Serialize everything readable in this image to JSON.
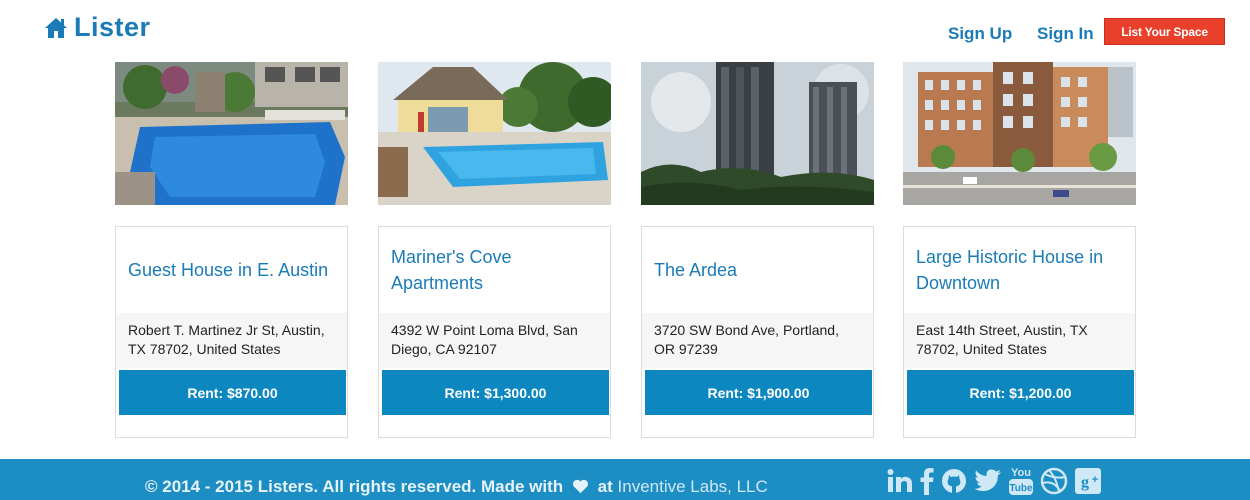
{
  "header": {
    "brand": "Lister",
    "sign_up": "Sign Up",
    "sign_in": "Sign In",
    "list_space": "List Your Space"
  },
  "listings": [
    {
      "title": "Guest House in E. Austin",
      "address": "Robert T. Martinez Jr St, Austin, TX 78702, United States",
      "rent": "Rent: $870.00",
      "photo": "pool-courtyard-photo"
    },
    {
      "title": "Mariner's Cove Apartments",
      "address": "4392 W Point Loma Blvd, San Diego, CA 92107",
      "rent": "Rent: $1,300.00",
      "photo": "clubhouse-pool-photo"
    },
    {
      "title": "The Ardea",
      "address": "3720 SW Bond Ave, Portland, OR 97239",
      "rent": "Rent: $1,900.00",
      "photo": "highrise-towers-photo"
    },
    {
      "title": "Large Historic House in Downtown",
      "address": "East 14th Street, Austin, TX 78702, United States",
      "rent": "Rent: $1,200.00",
      "photo": "city-block-photo"
    }
  ],
  "footer": {
    "copyright": "© 2014 - 2015 Listers. All rights reserved. Made with",
    "at": "at",
    "company": "Inventive Labs, LLC",
    "socials": [
      "linkedin-icon",
      "facebook-icon",
      "github-icon",
      "twitter-icon",
      "youtube-icon",
      "dribbble-icon",
      "google-plus-icon"
    ]
  },
  "colors": {
    "brand": "#1a7bb7",
    "accent": "#e8402a",
    "rent_button": "#0c87bf",
    "footer": "#1d8ec4"
  }
}
